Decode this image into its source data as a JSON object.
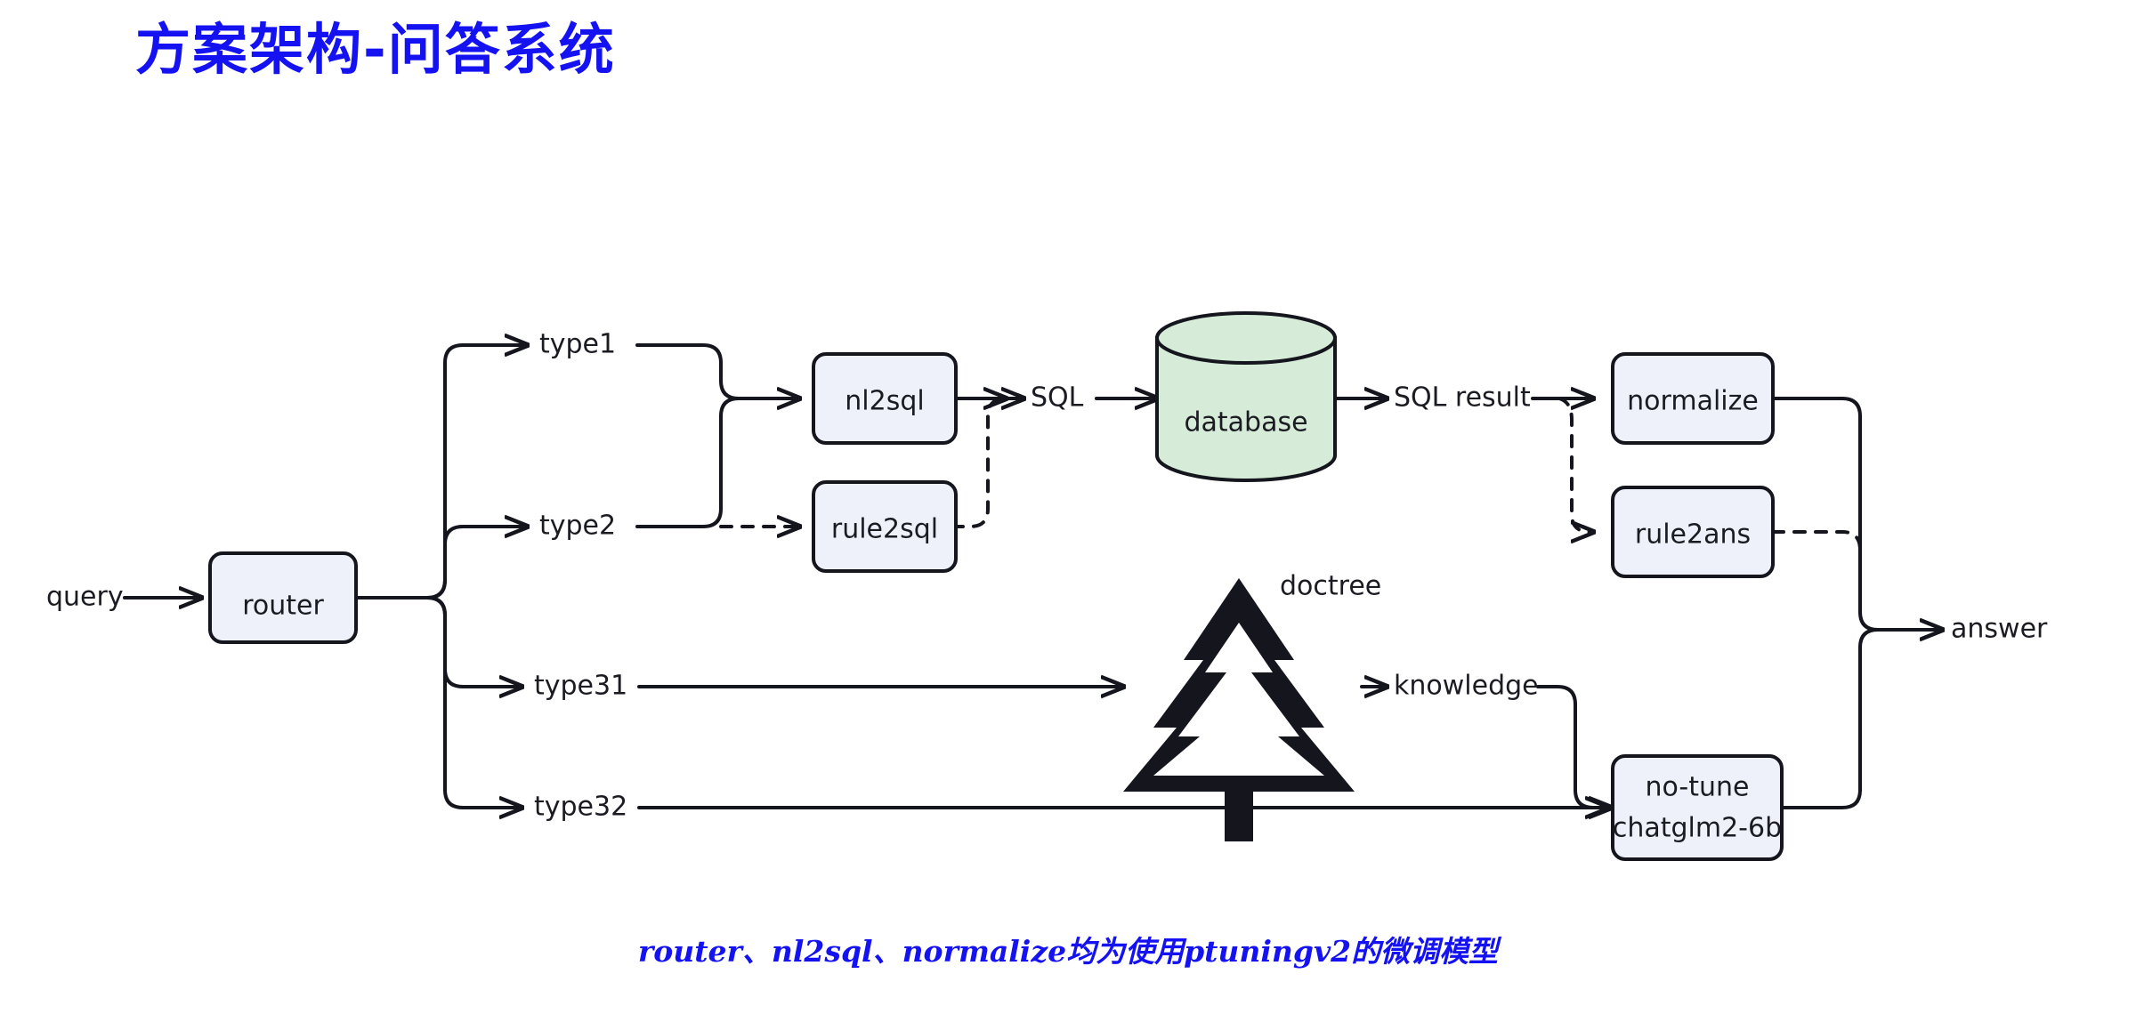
{
  "slide": {
    "title": "方案架构-问答系统",
    "caption": "router、nl2sql、normalize均为使用ptuningv2的微调模型",
    "title_color": "#1412f0",
    "caption_color": "#1412f0",
    "background": "#ffffff"
  },
  "theme": {
    "node_fill": "#eef1fa",
    "node_stroke": "#15161d",
    "database_fill": "#d6ecd9",
    "database_stroke": "#15161d",
    "edge_color": "#15161d",
    "text_color": "#1b1b22"
  },
  "diagram": {
    "type": "flowchart",
    "nodes": [
      {
        "id": "query",
        "label": "query",
        "shape": "text"
      },
      {
        "id": "router",
        "label": "router",
        "shape": "rounded-box"
      },
      {
        "id": "type1",
        "label": "type1",
        "shape": "text"
      },
      {
        "id": "type2",
        "label": "type2",
        "shape": "text"
      },
      {
        "id": "type31",
        "label": "type31",
        "shape": "text"
      },
      {
        "id": "type32",
        "label": "type32",
        "shape": "text"
      },
      {
        "id": "nl2sql",
        "label": "nl2sql",
        "shape": "rounded-box"
      },
      {
        "id": "rule2sql",
        "label": "rule2sql",
        "shape": "rounded-box"
      },
      {
        "id": "sql",
        "label": "SQL",
        "shape": "text"
      },
      {
        "id": "database",
        "label": "database",
        "shape": "cylinder"
      },
      {
        "id": "sqlresult",
        "label": "SQL result",
        "shape": "text"
      },
      {
        "id": "normalize",
        "label": "normalize",
        "shape": "rounded-box"
      },
      {
        "id": "rule2ans",
        "label": "rule2ans",
        "shape": "rounded-box"
      },
      {
        "id": "doctree",
        "label": "doctree",
        "shape": "tree-icon"
      },
      {
        "id": "knowledge",
        "label": "knowledge",
        "shape": "text"
      },
      {
        "id": "notune",
        "label_line1": "no-tune",
        "label_line2": "chatglm2-6b",
        "shape": "rounded-box"
      },
      {
        "id": "answer",
        "label": "answer",
        "shape": "text"
      }
    ],
    "edges": [
      {
        "from": "query",
        "to": "router",
        "style": "solid"
      },
      {
        "from": "router",
        "to": "type1",
        "style": "solid"
      },
      {
        "from": "router",
        "to": "type2",
        "style": "solid"
      },
      {
        "from": "router",
        "to": "type31",
        "style": "solid"
      },
      {
        "from": "router",
        "to": "type32",
        "style": "solid"
      },
      {
        "from": "type1",
        "to": "nl2sql",
        "style": "solid"
      },
      {
        "from": "type2",
        "to": "nl2sql",
        "style": "solid"
      },
      {
        "from": "type2",
        "to": "rule2sql",
        "style": "dashed"
      },
      {
        "from": "nl2sql",
        "to": "sql",
        "style": "solid"
      },
      {
        "from": "rule2sql",
        "to": "sql",
        "style": "dashed"
      },
      {
        "from": "sql",
        "to": "database",
        "style": "solid"
      },
      {
        "from": "database",
        "to": "sqlresult",
        "style": "solid"
      },
      {
        "from": "sqlresult",
        "to": "normalize",
        "style": "solid"
      },
      {
        "from": "sqlresult",
        "to": "rule2ans",
        "style": "dashed"
      },
      {
        "from": "type31",
        "to": "doctree",
        "style": "solid"
      },
      {
        "from": "doctree",
        "to": "knowledge",
        "style": "solid"
      },
      {
        "from": "knowledge",
        "to": "notune",
        "style": "solid"
      },
      {
        "from": "type32",
        "to": "notune",
        "style": "solid"
      },
      {
        "from": "normalize",
        "to": "answer",
        "style": "solid"
      },
      {
        "from": "rule2ans",
        "to": "answer",
        "style": "dashed"
      },
      {
        "from": "notune",
        "to": "answer",
        "style": "solid"
      }
    ]
  }
}
